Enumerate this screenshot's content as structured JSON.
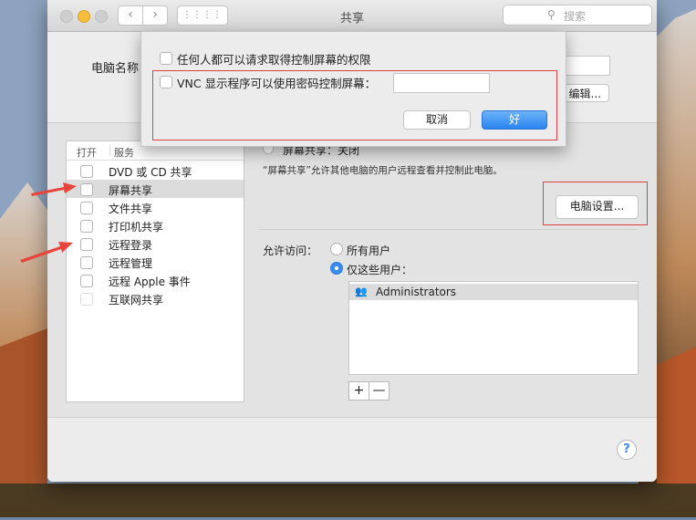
{
  "window": {
    "title": "共享"
  },
  "search": {
    "placeholder": "搜索"
  },
  "computer": {
    "name_label": "电脑名称",
    "edit_label": "编辑..."
  },
  "services": {
    "header_on": "打开",
    "header_service": "服务",
    "items": [
      {
        "label": "DVD 或 CD 共享",
        "checked": false
      },
      {
        "label": "屏幕共享",
        "checked": false,
        "selected": true
      },
      {
        "label": "文件共享",
        "checked": false
      },
      {
        "label": "打印机共享",
        "checked": false
      },
      {
        "label": "远程登录",
        "checked": false
      },
      {
        "label": "远程管理",
        "checked": false
      },
      {
        "label": "远程 Apple 事件",
        "checked": false
      },
      {
        "label": "互联网共享",
        "checked": false
      }
    ]
  },
  "detail": {
    "status": "屏幕共享：关闭",
    "description": "“屏幕共享”允许其他电脑的用户远程查看并控制此电脑。",
    "computer_settings_label": "电脑设置...",
    "allow_access_label": "允许访问：",
    "radio_all": "所有用户",
    "radio_only": "仅这些用户：",
    "users": [
      "Administrators"
    ],
    "add_label": "+",
    "remove_label": "—"
  },
  "sheet": {
    "anyone_label": "任何人都可以请求取得控制屏幕的权限",
    "vnc_label": "VNC 显示程序可以使用密码控制屏幕：",
    "password_value": "",
    "cancel_label": "取消",
    "ok_label": "好"
  },
  "help": {
    "label": "?"
  },
  "colors": {
    "accent": "#3a8cf4",
    "highlight": "#e04040",
    "arrow": "#e8453c"
  }
}
